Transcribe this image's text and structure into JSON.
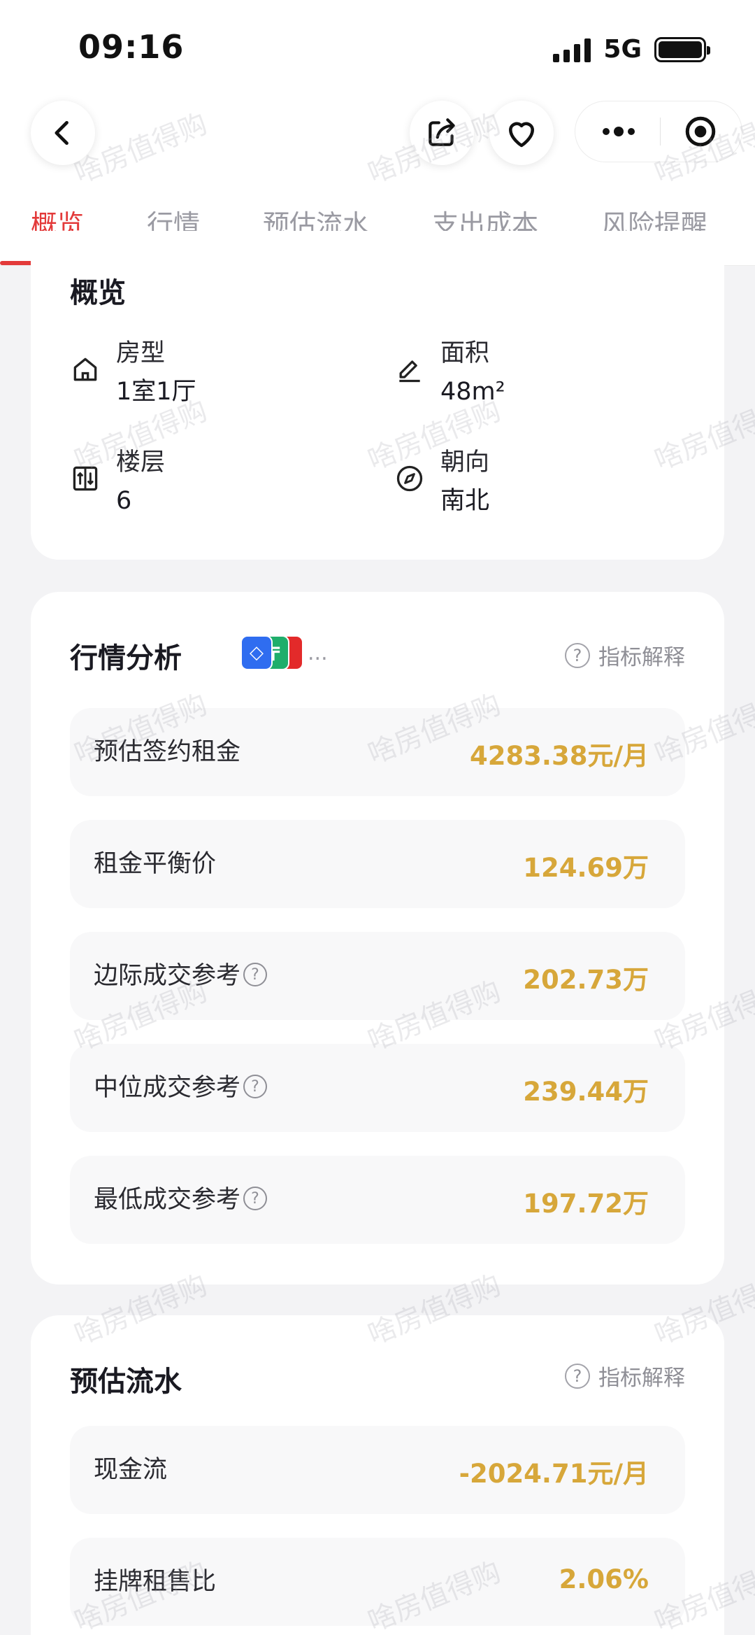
{
  "status": {
    "time": "09:16",
    "network": "5G"
  },
  "tabs": [
    {
      "label": "概览",
      "active": true
    },
    {
      "label": "行情"
    },
    {
      "label": "预估流水"
    },
    {
      "label": "支出成本"
    },
    {
      "label": "风险提醒"
    }
  ],
  "overview": {
    "title": "概览",
    "items": [
      {
        "label": "房型",
        "value": "1室1厅",
        "icon": "house-icon"
      },
      {
        "label": "面积",
        "value": "48m²",
        "icon": "edit-icon"
      },
      {
        "label": "楼层",
        "value": "6",
        "icon": "elevator-icon"
      },
      {
        "label": "朝向",
        "value": "南北",
        "icon": "compass-icon"
      }
    ]
  },
  "market": {
    "title": "行情分析",
    "explain_label": "指标解释",
    "ellipsis": "...",
    "rows": [
      {
        "label": "预估签约租金",
        "value": "4283.38元/月"
      },
      {
        "label": "租金平衡价",
        "value": "124.69万"
      },
      {
        "label": "边际成交参考",
        "value": "202.73万"
      },
      {
        "label": "中位成交参考",
        "value": "239.44万"
      },
      {
        "label": "最低成交参考",
        "value": "197.72万"
      }
    ]
  },
  "cashflow": {
    "title": "预估流水",
    "explain_label": "指标解释",
    "rows": [
      {
        "label": "现金流",
        "value": "-2024.71元/月"
      },
      {
        "label": "挂牌租售比",
        "value": "2.06%"
      }
    ]
  },
  "watermark": "啥房值得购",
  "colors": {
    "accent": "#e33a3a",
    "value": "#d7a73a"
  }
}
